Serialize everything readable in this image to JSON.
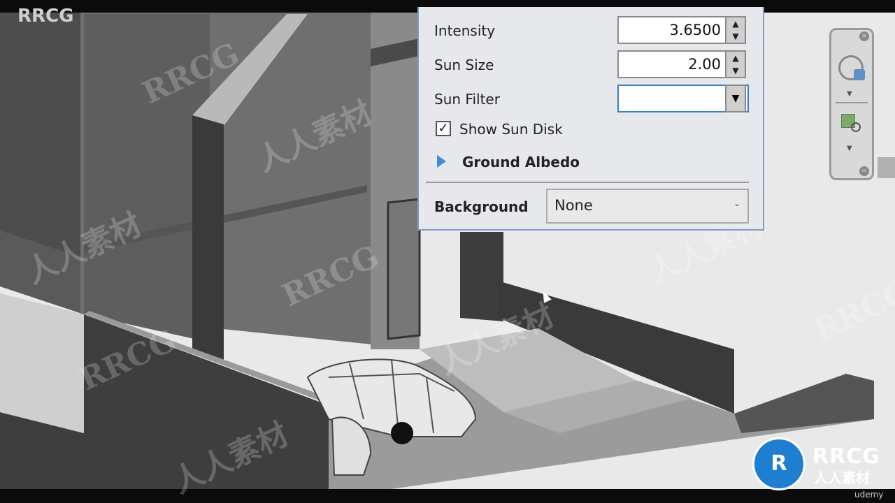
{
  "branding": {
    "top_left": "RRCG",
    "logo_text_1": "RRCG",
    "logo_text_2": "人人素材",
    "udemy": "udemy"
  },
  "watermarks": [
    "RRCG",
    "人人素材"
  ],
  "panel": {
    "intensity": {
      "label": "Intensity",
      "value": "3.6500"
    },
    "sun_size": {
      "label": "Sun Size",
      "value": "2.00"
    },
    "sun_filter": {
      "label": "Sun Filter",
      "value": ""
    },
    "show_sun_disk": {
      "label": "Show Sun Disk",
      "checked": true
    },
    "ground_albedo": {
      "label": "Ground Albedo",
      "expanded": false
    },
    "background": {
      "label": "Background",
      "value": "None"
    }
  },
  "nav_bar": {
    "icons": [
      "close-icon",
      "steering-wheel-icon",
      "dropdown-arrow-icon",
      "zoom-region-icon",
      "dropdown-arrow-icon",
      "collapse-icon"
    ]
  },
  "colors": {
    "accent": "#3c8fd8",
    "panel_border": "#7f9cc4"
  }
}
